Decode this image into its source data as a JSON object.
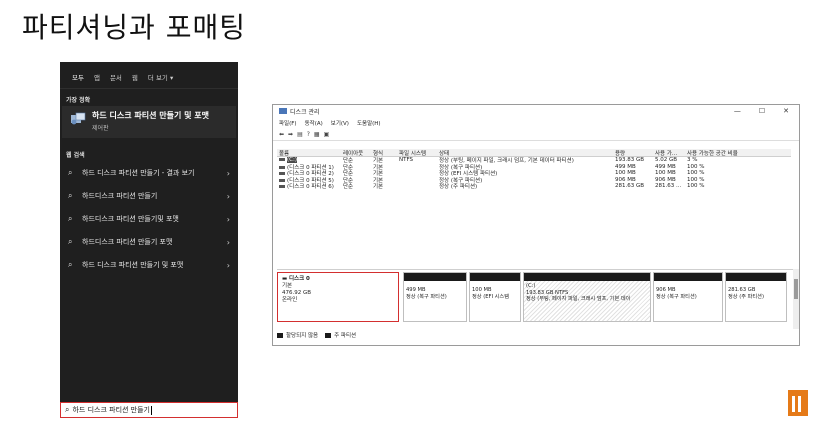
{
  "slide": {
    "title": "파티셔닝과 포매팅"
  },
  "start_menu": {
    "tabs": [
      "모두",
      "앱",
      "문서",
      "웹",
      "더 보기 ▾"
    ],
    "best_match_header": "가장 정확",
    "best_match": {
      "title": "하드 디스크 파티션 만들기 및 포맷",
      "subtitle": "제어판"
    },
    "web_search_header": "웹 검색",
    "suggestions": [
      {
        "label": "하드 디스크 파티션 만들기 - 결과 보기"
      },
      {
        "label": "하드디스크 파티션 만들기"
      },
      {
        "label": "하드디스크 파티션 만들기및 포맷"
      },
      {
        "label": "하드디스크 파티션 만들기 포맷"
      },
      {
        "label": "하드 디스크 파티션 만들기 및 포맷"
      }
    ],
    "search_value": "하드 디스크 파티션 만들기"
  },
  "disk_mgmt": {
    "window_title": "디스크 관리",
    "window_controls": [
      "—",
      "☐",
      "✕"
    ],
    "menus": [
      "파일(F)",
      "동작(A)",
      "보기(V)",
      "도움말(H)"
    ],
    "toolbar_icons": [
      "back-icon",
      "forward-icon",
      "properties-icon",
      "help-icon",
      "disk-icon",
      "refresh-icon"
    ],
    "columns": [
      "볼륨",
      "레이아웃",
      "형식",
      "파일 시스템",
      "상태",
      "용량",
      "사용 가...",
      "사용 가능한 공간 비율"
    ],
    "rows": [
      [
        "(C:)",
        "단순",
        "기본",
        "NTFS",
        "정상 (부팅, 페이지 파일, 크래시 덤프, 기본 데이터 파티션)",
        "193.83 GB",
        "5.02 GB",
        "3 %"
      ],
      [
        "(디스크 0 파티션 1)",
        "단순",
        "기본",
        "",
        "정상 (복구 파티션)",
        "499 MB",
        "499 MB",
        "100 %"
      ],
      [
        "(디스크 0 파티션 2)",
        "단순",
        "기본",
        "",
        "정상 (EFI 시스템 파티션)",
        "100 MB",
        "100 MB",
        "100 %"
      ],
      [
        "(디스크 0 파티션 5)",
        "단순",
        "기본",
        "",
        "정상 (복구 파티션)",
        "906 MB",
        "906 MB",
        "100 %"
      ],
      [
        "(디스크 0 파티션 6)",
        "단순",
        "기본",
        "",
        "정상 (주 파티션)",
        "281.63 GB",
        "281.63 ...",
        "100 %"
      ]
    ],
    "disk": {
      "name": "디스크 0",
      "type": "기본",
      "size": "476.92 GB",
      "status": "온라인"
    },
    "partitions": [
      {
        "name": "",
        "size": "499 MB",
        "status": "정상 (복구 파티션)"
      },
      {
        "name": "",
        "size": "100 MB",
        "status": "정상 (EFI 시스템"
      },
      {
        "name": "(C:)",
        "size": "193.83 GB NTFS",
        "status": "정상 (부팅, 페이지 파일, 크래시 덤프, 기본 데이"
      },
      {
        "name": "",
        "size": "906 MB",
        "status": "정상 (복구 파티션)"
      },
      {
        "name": "",
        "size": "281.63 GB",
        "status": "정상 (주 파티션)"
      }
    ],
    "legend": [
      {
        "label": "할당되지 않음",
        "color": "#1a1a1a"
      },
      {
        "label": "주 파티션",
        "color": "#1a1a1a"
      }
    ]
  }
}
